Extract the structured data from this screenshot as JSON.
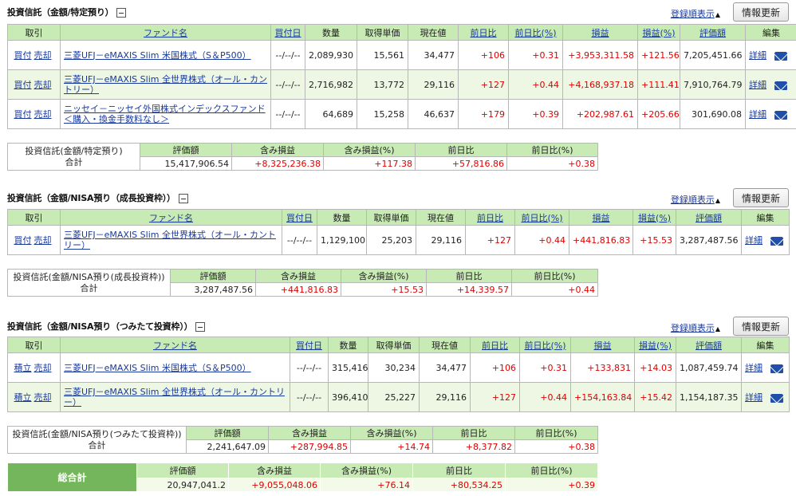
{
  "sections": [
    {
      "title": "投資信託（金額/特定預り）",
      "order_link": "登録順表示",
      "refresh": "情報更新",
      "headers": [
        "取引",
        "ファンド名",
        "買付日",
        "数量",
        "取得単価",
        "現在値",
        "前日比",
        "前日比(%)",
        "損益",
        "損益(%)",
        "評価額",
        "編集"
      ],
      "rows": [
        {
          "buy": "買付",
          "sell": "売却",
          "fund": "三菱UFJ－eMAXIS Slim 米国株式（S＆P500）",
          "date": "--/--/--",
          "qty": "2,089,930",
          "cost": "15,561",
          "price": "34,477",
          "chg": "+106",
          "chgp": "+0.31",
          "pl": "+3,953,311.58",
          "plp": "+121.56",
          "val": "7,205,451.66",
          "edit": "詳細"
        },
        {
          "buy": "買付",
          "sell": "売却",
          "fund": "三菱UFJ－eMAXIS Slim 全世界株式（オール・カントリー）",
          "date": "--/--/--",
          "qty": "2,716,982",
          "cost": "13,772",
          "price": "29,116",
          "chg": "+127",
          "chgp": "+0.44",
          "pl": "+4,168,937.18",
          "plp": "+111.41",
          "val": "7,910,764.79",
          "edit": "詳細"
        },
        {
          "buy": "買付",
          "sell": "売却",
          "fund": "ニッセイ－ニッセイ外国株式インデックスファンド＜購入・換金手数料なし＞",
          "date": "--/--/--",
          "qty": "64,689",
          "cost": "15,258",
          "price": "46,637",
          "chg": "+179",
          "chgp": "+0.39",
          "pl": "+202,987.61",
          "plp": "+205.66",
          "val": "301,690.08",
          "edit": "詳細"
        }
      ],
      "summary": {
        "label1": "投資信託(金額/特定預り)",
        "label2": "合計",
        "headers": [
          "評価額",
          "含み損益",
          "含み損益(%)",
          "前日比",
          "前日比(%)"
        ],
        "values": [
          "15,417,906.54",
          "+8,325,236.38",
          "+117.38",
          "+57,816.86",
          "+0.38"
        ]
      }
    },
    {
      "title": "投資信託（金額/NISA預り（成長投資枠））",
      "order_link": "登録順表示",
      "refresh": "情報更新",
      "headers": [
        "取引",
        "ファンド名",
        "買付日",
        "数量",
        "取得単価",
        "現在値",
        "前日比",
        "前日比(%)",
        "損益",
        "損益(%)",
        "評価額",
        "編集"
      ],
      "rows": [
        {
          "buy": "買付",
          "sell": "売却",
          "fund": "三菱UFJ－eMAXIS Slim 全世界株式（オール・カントリー）",
          "date": "--/--/--",
          "qty": "1,129,100",
          "cost": "25,203",
          "price": "29,116",
          "chg": "+127",
          "chgp": "+0.44",
          "pl": "+441,816.83",
          "plp": "+15.53",
          "val": "3,287,487.56",
          "edit": "詳細"
        }
      ],
      "summary": {
        "label1": "投資信託(金額/NISA預り(成長投資枠))",
        "label2": "合計",
        "headers": [
          "評価額",
          "含み損益",
          "含み損益(%)",
          "前日比",
          "前日比(%)"
        ],
        "values": [
          "3,287,487.56",
          "+441,816.83",
          "+15.53",
          "+14,339.57",
          "+0.44"
        ]
      }
    },
    {
      "title": "投資信託（金額/NISA預り（つみたて投資枠））",
      "order_link": "登録順表示",
      "refresh": "情報更新",
      "headers": [
        "取引",
        "ファンド名",
        "買付日",
        "数量",
        "取得単価",
        "現在値",
        "前日比",
        "前日比(%)",
        "損益",
        "損益(%)",
        "評価額",
        "編集"
      ],
      "rows": [
        {
          "buy": "積立",
          "sell": "売却",
          "fund": "三菱UFJ－eMAXIS Slim 米国株式（S＆P500）",
          "date": "--/--/--",
          "qty": "315,416",
          "cost": "30,234",
          "price": "34,477",
          "chg": "+106",
          "chgp": "+0.31",
          "pl": "+133,831",
          "plp": "+14.03",
          "val": "1,087,459.74",
          "edit": "詳細"
        },
        {
          "buy": "積立",
          "sell": "売却",
          "fund": "三菱UFJ－eMAXIS Slim 全世界株式（オール・カントリー）",
          "date": "--/--/--",
          "qty": "396,410",
          "cost": "25,227",
          "price": "29,116",
          "chg": "+127",
          "chgp": "+0.44",
          "pl": "+154,163.84",
          "plp": "+15.42",
          "val": "1,154,187.35",
          "edit": "詳細"
        }
      ],
      "summary": {
        "label1": "投資信託(金額/NISA預り(つみたて投資枠))",
        "label2": "合計",
        "headers": [
          "評価額",
          "含み損益",
          "含み損益(%)",
          "前日比",
          "前日比(%)"
        ],
        "values": [
          "2,241,647.09",
          "+287,994.85",
          "+14.74",
          "+8,377.82",
          "+0.38"
        ]
      }
    }
  ],
  "grand_total": {
    "label": "総合計",
    "headers": [
      "評価額",
      "含み損益",
      "含み損益(%)",
      "前日比",
      "前日比(%)"
    ],
    "values": [
      "20,947,041.2",
      "+9,055,048.06",
      "+76.14",
      "+80,534.25",
      "+0.39"
    ]
  },
  "colors": {
    "header_green": "#c8eab4",
    "positive_red": "#e00000",
    "link_blue": "#1a3a9c",
    "total_green": "#74b65b"
  },
  "icons": {
    "mail": "mail-icon",
    "collapse": "collapse-minus-icon"
  }
}
